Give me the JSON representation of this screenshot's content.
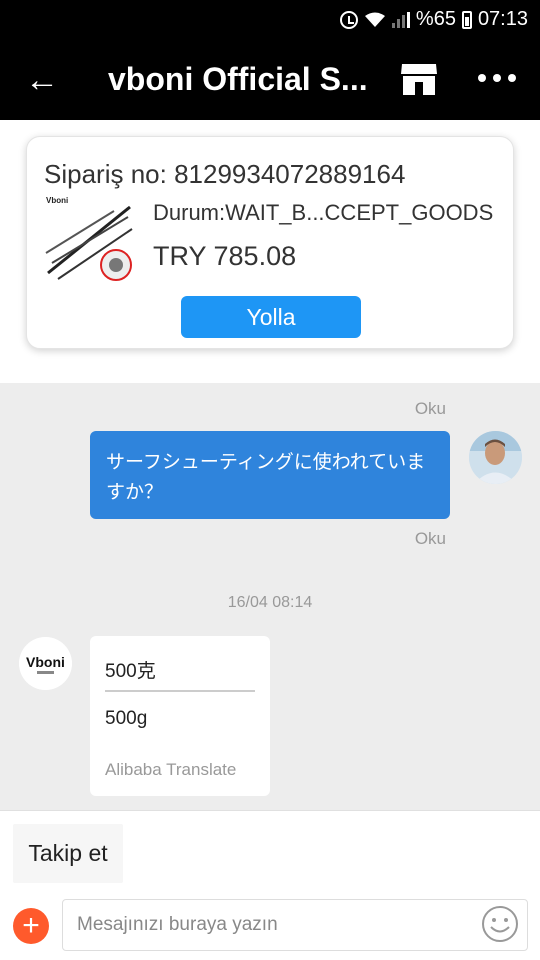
{
  "status_bar": {
    "battery": "%65",
    "time": "07:13"
  },
  "header": {
    "title": "vboni Official S..."
  },
  "order": {
    "order_no": "Sipariş no: 8129934072889164",
    "status": "Durum:WAIT_B...CCEPT_GOODS",
    "price": "TRY 785.08",
    "product_brand": "Vboni",
    "send_label": "Yolla"
  },
  "chat": {
    "read_label_1": "Oku",
    "outgoing_message": "サーフシューティングに使われていますか？",
    "read_label_2": "Oku",
    "timestamp": "16/04 08:14",
    "shop_logo_text": "Vboni",
    "incoming_original": "500克",
    "incoming_translated": "500g",
    "translate_provider": "Alibaba Translate"
  },
  "bottom": {
    "follow_label": "Takip et",
    "plus_label": "+",
    "input_placeholder": "Mesajınızı buraya yazın"
  },
  "colors": {
    "accent_blue": "#1e96f5",
    "bubble_blue": "#2f84dc",
    "plus_orange": "#ff5a2c"
  }
}
